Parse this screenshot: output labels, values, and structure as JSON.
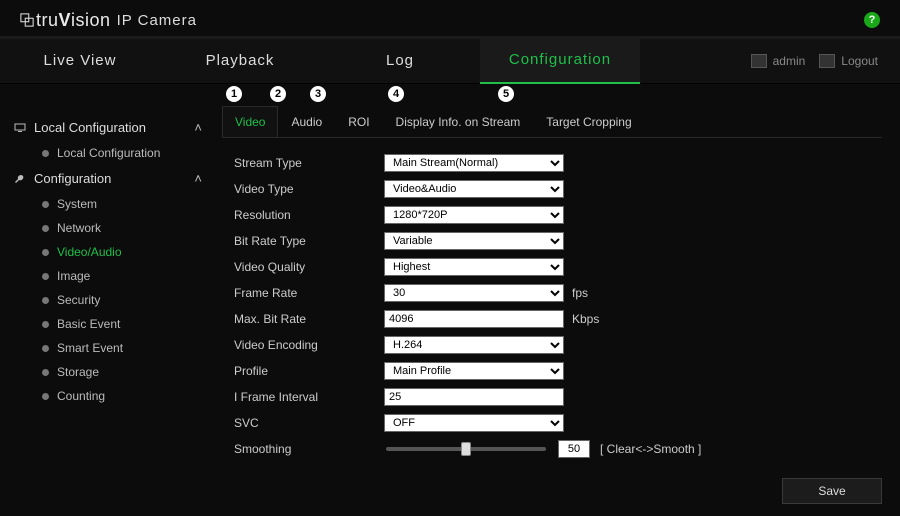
{
  "brand": {
    "name_prefix": "tru",
    "name_bold": "V",
    "name_suffix": "ision",
    "product": "IP Camera"
  },
  "help": "?",
  "topnav": {
    "tabs": [
      "Live View",
      "Playback",
      "Log",
      "Configuration"
    ],
    "active": 3,
    "user": "admin",
    "logout": "Logout"
  },
  "callouts": {
    "n1": "1",
    "n2": "2",
    "n3": "3",
    "n4": "4",
    "n5": "5"
  },
  "sidebar": {
    "cat1": {
      "label": "Local Configuration",
      "items": [
        "Local Configuration"
      ]
    },
    "cat2": {
      "label": "Configuration",
      "items": [
        "System",
        "Network",
        "Video/Audio",
        "Image",
        "Security",
        "Basic Event",
        "Smart Event",
        "Storage",
        "Counting"
      ],
      "active": 2
    }
  },
  "subtabs": {
    "items": [
      "Video",
      "Audio",
      "ROI",
      "Display Info. on Stream",
      "Target Cropping"
    ],
    "active": 0
  },
  "form": {
    "stream_type": {
      "label": "Stream Type",
      "value": "Main Stream(Normal)"
    },
    "video_type": {
      "label": "Video Type",
      "value": "Video&Audio"
    },
    "resolution": {
      "label": "Resolution",
      "value": "1280*720P"
    },
    "bit_rate_type": {
      "label": "Bit Rate Type",
      "value": "Variable"
    },
    "video_quality": {
      "label": "Video Quality",
      "value": "Highest"
    },
    "frame_rate": {
      "label": "Frame Rate",
      "value": "30",
      "unit": "fps"
    },
    "max_bit_rate": {
      "label": "Max. Bit Rate",
      "value": "4096",
      "unit": "Kbps"
    },
    "video_encoding": {
      "label": "Video Encoding",
      "value": "H.264"
    },
    "profile": {
      "label": "Profile",
      "value": "Main Profile"
    },
    "i_frame": {
      "label": "I Frame Interval",
      "value": "25"
    },
    "svc": {
      "label": "SVC",
      "value": "OFF"
    },
    "smoothing": {
      "label": "Smoothing",
      "value": "50",
      "hint": "[ Clear<->Smooth ]"
    }
  },
  "save": "Save"
}
